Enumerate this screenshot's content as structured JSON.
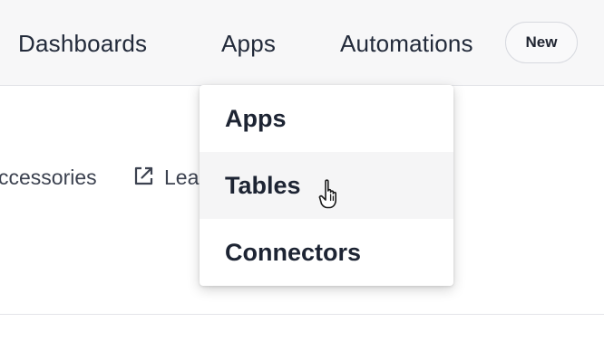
{
  "nav": {
    "dashboards": "Dashboards",
    "apps": "Apps",
    "automations": "Automations",
    "automations_badge": "New"
  },
  "subbar": {
    "accessories_text": "ccessories",
    "external_link_text": "Lea"
  },
  "apps_menu": {
    "items": [
      {
        "label": "Apps"
      },
      {
        "label": "Tables"
      },
      {
        "label": "Connectors"
      }
    ]
  },
  "icons": {
    "external_link": "external-link-icon",
    "cursor": "hand-pointer-cursor-icon"
  },
  "colors": {
    "topbar_bg": "#f7f7f8",
    "hover_bg": "#f5f5f6",
    "text": "#222a3a"
  }
}
